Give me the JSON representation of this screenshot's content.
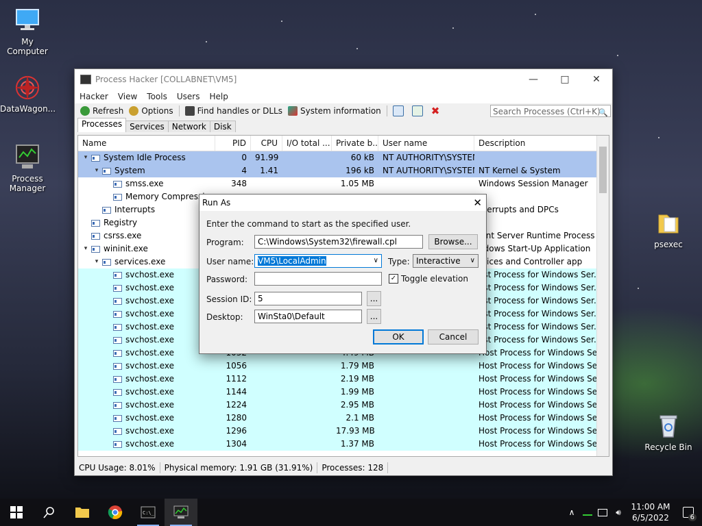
{
  "desktop": {
    "icons": [
      {
        "label": "My Computer",
        "icon": "monitor-icon"
      },
      {
        "label": "DataWagon...",
        "icon": "mandala-icon"
      },
      {
        "label": "Process Manager",
        "icon": "process-monitor-icon"
      },
      {
        "label": "psexec",
        "icon": "folder-icon"
      },
      {
        "label": "Recycle Bin",
        "icon": "recycle-bin-icon"
      }
    ]
  },
  "window": {
    "title": "Process Hacker [COLLABNET\\VM5]",
    "menu": [
      "Hacker",
      "View",
      "Tools",
      "Users",
      "Help"
    ],
    "toolbar": {
      "refresh": "Refresh",
      "options": "Options",
      "find_handles": "Find handles or DLLs",
      "system_info": "System information"
    },
    "search_placeholder": "Search Processes (Ctrl+K)",
    "tabs": [
      "Processes",
      "Services",
      "Network",
      "Disk"
    ],
    "columns": [
      "Name",
      "PID",
      "CPU",
      "I/O total ...",
      "Private b...",
      "User name",
      "Description"
    ],
    "rows": [
      {
        "name": "System Idle Process",
        "pid": "0",
        "cpu": "91.99",
        "io": "",
        "priv": "60 kB",
        "user": "NT AUTHORITY\\SYSTEM",
        "desc": "",
        "level": 0,
        "tree": "▾",
        "kind": "sys"
      },
      {
        "name": "System",
        "pid": "4",
        "cpu": "1.41",
        "io": "",
        "priv": "196 kB",
        "user": "NT AUTHORITY\\SYSTEM",
        "desc": "NT Kernel & System",
        "level": 1,
        "tree": "▾",
        "kind": "sys"
      },
      {
        "name": "smss.exe",
        "pid": "348",
        "cpu": "",
        "io": "",
        "priv": "1.05 MB",
        "user": "",
        "desc": "Windows Session Manager",
        "level": 2,
        "tree": "",
        "kind": ""
      },
      {
        "name": "Memory Compressi",
        "pid": "",
        "cpu": "",
        "io": "",
        "priv": "",
        "user": "",
        "desc": "",
        "level": 2,
        "tree": "",
        "kind": ""
      },
      {
        "name": "Interrupts",
        "pid": "",
        "cpu": "",
        "io": "",
        "priv": "",
        "user": "",
        "desc": "nterrupts and DPCs",
        "level": 1,
        "tree": "",
        "kind": ""
      },
      {
        "name": "Registry",
        "pid": "",
        "cpu": "",
        "io": "",
        "priv": "",
        "user": "",
        "desc": "",
        "level": 0,
        "tree": "",
        "kind": ""
      },
      {
        "name": "csrss.exe",
        "pid": "",
        "cpu": "",
        "io": "",
        "priv": "",
        "user": "",
        "desc": "ient Server Runtime Process",
        "level": 0,
        "tree": "",
        "kind": ""
      },
      {
        "name": "wininit.exe",
        "pid": "",
        "cpu": "",
        "io": "",
        "priv": "",
        "user": "",
        "desc": "ndows Start-Up Application",
        "level": 0,
        "tree": "▾",
        "kind": ""
      },
      {
        "name": "services.exe",
        "pid": "",
        "cpu": "",
        "io": "",
        "priv": "",
        "user": "",
        "desc": "rvices and Controller app",
        "level": 1,
        "tree": "▾",
        "kind": ""
      },
      {
        "name": "svchost.exe",
        "pid": "",
        "cpu": "",
        "io": "",
        "priv": "",
        "user": "",
        "desc": "ost Process for Windows Ser...",
        "level": 2,
        "tree": "",
        "kind": "svc"
      },
      {
        "name": "svchost.exe",
        "pid": "",
        "cpu": "",
        "io": "",
        "priv": "",
        "user": "",
        "desc": "ost Process for Windows Ser...",
        "level": 2,
        "tree": "",
        "kind": "svc"
      },
      {
        "name": "svchost.exe",
        "pid": "",
        "cpu": "",
        "io": "",
        "priv": "",
        "user": "",
        "desc": "ost Process for Windows Ser...",
        "level": 2,
        "tree": "",
        "kind": "svc"
      },
      {
        "name": "svchost.exe",
        "pid": "",
        "cpu": "",
        "io": "",
        "priv": "",
        "user": "",
        "desc": "ost Process for Windows Ser...",
        "level": 2,
        "tree": "",
        "kind": "svc"
      },
      {
        "name": "svchost.exe",
        "pid": "",
        "cpu": "",
        "io": "",
        "priv": "",
        "user": "",
        "desc": "ost Process for Windows Ser...",
        "level": 2,
        "tree": "",
        "kind": "svc"
      },
      {
        "name": "svchost.exe",
        "pid": "",
        "cpu": "",
        "io": "",
        "priv": "",
        "user": "",
        "desc": "ost Process for Windows Ser...",
        "level": 2,
        "tree": "",
        "kind": "svc"
      },
      {
        "name": "svchost.exe",
        "pid": "1032",
        "cpu": "",
        "io": "",
        "priv": "4.49 MB",
        "user": "",
        "desc": "Host Process for Windows Ser...",
        "level": 2,
        "tree": "",
        "kind": "svc"
      },
      {
        "name": "svchost.exe",
        "pid": "1056",
        "cpu": "",
        "io": "",
        "priv": "1.79 MB",
        "user": "",
        "desc": "Host Process for Windows Ser...",
        "level": 2,
        "tree": "",
        "kind": "svc"
      },
      {
        "name": "svchost.exe",
        "pid": "1112",
        "cpu": "",
        "io": "",
        "priv": "2.19 MB",
        "user": "",
        "desc": "Host Process for Windows Ser...",
        "level": 2,
        "tree": "",
        "kind": "svc"
      },
      {
        "name": "svchost.exe",
        "pid": "1144",
        "cpu": "",
        "io": "",
        "priv": "1.99 MB",
        "user": "",
        "desc": "Host Process for Windows Ser...",
        "level": 2,
        "tree": "",
        "kind": "svc"
      },
      {
        "name": "svchost.exe",
        "pid": "1224",
        "cpu": "",
        "io": "",
        "priv": "2.95 MB",
        "user": "",
        "desc": "Host Process for Windows Ser...",
        "level": 2,
        "tree": "",
        "kind": "svc"
      },
      {
        "name": "svchost.exe",
        "pid": "1280",
        "cpu": "",
        "io": "",
        "priv": "2.1 MB",
        "user": "",
        "desc": "Host Process for Windows Ser...",
        "level": 2,
        "tree": "",
        "kind": "svc"
      },
      {
        "name": "svchost.exe",
        "pid": "1296",
        "cpu": "",
        "io": "",
        "priv": "17.93 MB",
        "user": "",
        "desc": "Host Process for Windows Ser...",
        "level": 2,
        "tree": "",
        "kind": "svc"
      },
      {
        "name": "svchost.exe",
        "pid": "1304",
        "cpu": "",
        "io": "",
        "priv": "1.37 MB",
        "user": "",
        "desc": "Host Process for Windows Ser...",
        "level": 2,
        "tree": "",
        "kind": "svc"
      }
    ],
    "status": {
      "cpu": "CPU Usage: 8.01%",
      "memory": "Physical memory: 1.91 GB (31.91%)",
      "processes": "Processes: 128"
    }
  },
  "dialog": {
    "title": "Run As",
    "instruction": "Enter the command to start as the specified user.",
    "program_label": "Program:",
    "program_value": "C:\\Windows\\System32\\firewall.cpl",
    "browse": "Browse...",
    "username_label": "User name:",
    "username_value": "VM5\\LocalAdmin",
    "type_label": "Type:",
    "type_value": "Interactive",
    "password_label": "Password:",
    "password_value": "",
    "toggle_elevation": "Toggle elevation",
    "toggle_checked": true,
    "session_label": "Session ID:",
    "session_value": "5",
    "desktop_label": "Desktop:",
    "desktop_value": "WinSta0\\Default",
    "ellipsis": "...",
    "ok": "OK",
    "cancel": "Cancel"
  },
  "taskbar": {
    "time": "11:00 AM",
    "date": "6/5/2022",
    "notification_count": "6"
  }
}
